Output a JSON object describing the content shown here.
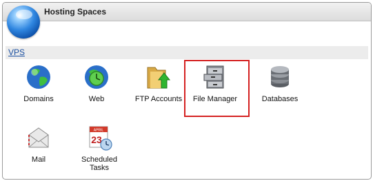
{
  "panel": {
    "title": "Hosting Spaces"
  },
  "section": {
    "link": "VPS"
  },
  "tiles": {
    "domains": "Domains",
    "web": "Web",
    "ftp": "FTP Accounts",
    "filemanager": "File Manager",
    "databases": "Databases",
    "mail": "Mail",
    "tasks": "Scheduled Tasks"
  },
  "calendar_icon": {
    "month": "APRIL",
    "day": "23"
  },
  "colors": {
    "highlight": "#d42020",
    "link": "#1a4fa0"
  }
}
